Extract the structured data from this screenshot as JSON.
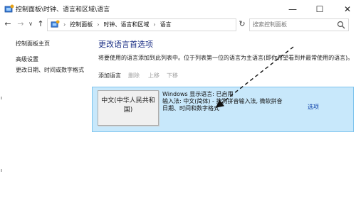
{
  "window": {
    "title": "控制面板\\时钟、语言和区域\\语言",
    "minimize_glyph": "—",
    "maximize_glyph": "☐",
    "close_glyph": "✕",
    "icon": "control-panel-icon"
  },
  "nav": {
    "back_glyph": "←",
    "forward_glyph": "→",
    "recent_glyph": "∨",
    "up_glyph": "↑",
    "breadcrumbs": [
      "控制面板",
      "时钟、语言和区域",
      "语言"
    ],
    "crumb_separator": "›",
    "dropdown_glyph": "∨",
    "refresh_glyph": "↻",
    "search_placeholder": "搜索控制面板"
  },
  "sidebar": {
    "home": "控制面板主页",
    "links": [
      "高级设置",
      "更改日期、时间或数字格式"
    ]
  },
  "main": {
    "title": "更改语言首选项",
    "description": "将要使用的语言添加到此列表中。位于列表第一位的语言为主语言(即你希望看到并最常使用的语言)。",
    "toolbar": {
      "add": "添加语言",
      "remove": "删除",
      "move_up": "上移",
      "move_down": "下移"
    },
    "language": {
      "name": "中文(中华人民共和国)",
      "display_status": "Windows 显示语言: 已启用",
      "input_methods": "输入法: 中文(简体) - 搜狗拼音输入法, 微软拼音",
      "formats": "日期、时间和数字格式",
      "options_label": "选项"
    }
  },
  "colors": {
    "accent_title": "#1e3287",
    "link": "#0b3fa8",
    "row_highlight": "#c8e8fb",
    "disabled_text": "#a0a0a0"
  }
}
